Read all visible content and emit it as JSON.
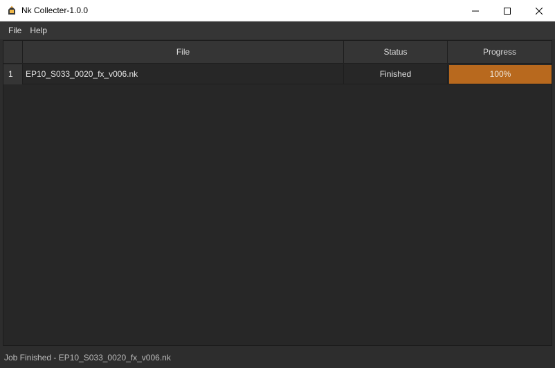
{
  "window": {
    "title": "Nk Collecter-1.0.0",
    "app_icon": "nuke-app-icon",
    "controls": [
      "minimize-icon",
      "maximize-icon",
      "close-icon"
    ]
  },
  "menu": {
    "items": [
      {
        "label": "File"
      },
      {
        "label": "Help"
      }
    ]
  },
  "table": {
    "columns": [
      "File",
      "Status",
      "Progress"
    ],
    "rows": [
      {
        "index": "1",
        "file": "EP10_S033_0020_fx_v006.nk",
        "status": "Finished",
        "progress": 100,
        "progress_label": "100%"
      }
    ],
    "progress_color": "#b8691e"
  },
  "status_bar": {
    "message": "Job Finished - EP10_S033_0020_fx_v006.nk"
  }
}
